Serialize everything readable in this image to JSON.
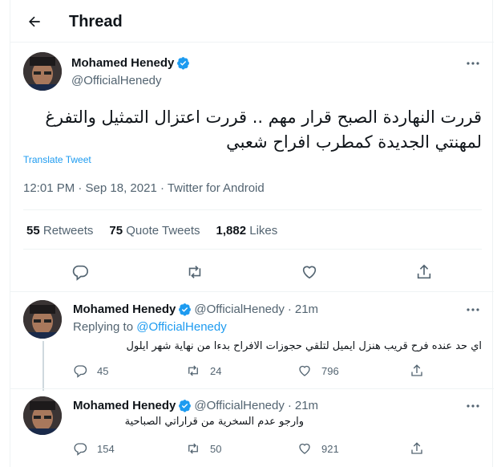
{
  "header": {
    "title": "Thread"
  },
  "main_tweet": {
    "author_name": "Mohamed Henedy",
    "author_handle": "@OfficialHenedy",
    "text_line1": "قررت النهاردة الصبح قرار مهم .. قررت اعتزال التمثيل والتفرغ",
    "text_line2": "لمهنتي الجديدة كمطرب افراح شعبي",
    "translate_label": "Translate Tweet",
    "timestamp": "12:01 PM · Sep 18, 2021 · Twitter for Android",
    "stats": {
      "retweets_count": "55",
      "retweets_label": "Retweets",
      "quote_count": "75",
      "quote_label": "Quote Tweets",
      "likes_count": "1,882",
      "likes_label": "Likes"
    }
  },
  "replies": [
    {
      "author_name": "Mohamed Henedy",
      "author_handle": "@OfficialHenedy",
      "time": "21m",
      "replying_prefix": "Replying to",
      "replying_handle": "@OfficialHenedy",
      "text": "اي حد عنده فرح قريب هنزل ايميل لتلقي حجوزات الافراح  بدءا من نهاية شهر ايلول",
      "reply_count": "45",
      "retweet_count": "24",
      "like_count": "796"
    },
    {
      "author_name": "Mohamed Henedy",
      "author_handle": "@OfficialHenedy",
      "time": "21m",
      "text": "وارجو عدم السخرية من قراراتي الصباحية",
      "reply_count": "154",
      "retweet_count": "50",
      "like_count": "921"
    }
  ],
  "colors": {
    "accent": "#1d9bf0",
    "secondary_text": "#536471",
    "primary_text": "#0f1419"
  }
}
